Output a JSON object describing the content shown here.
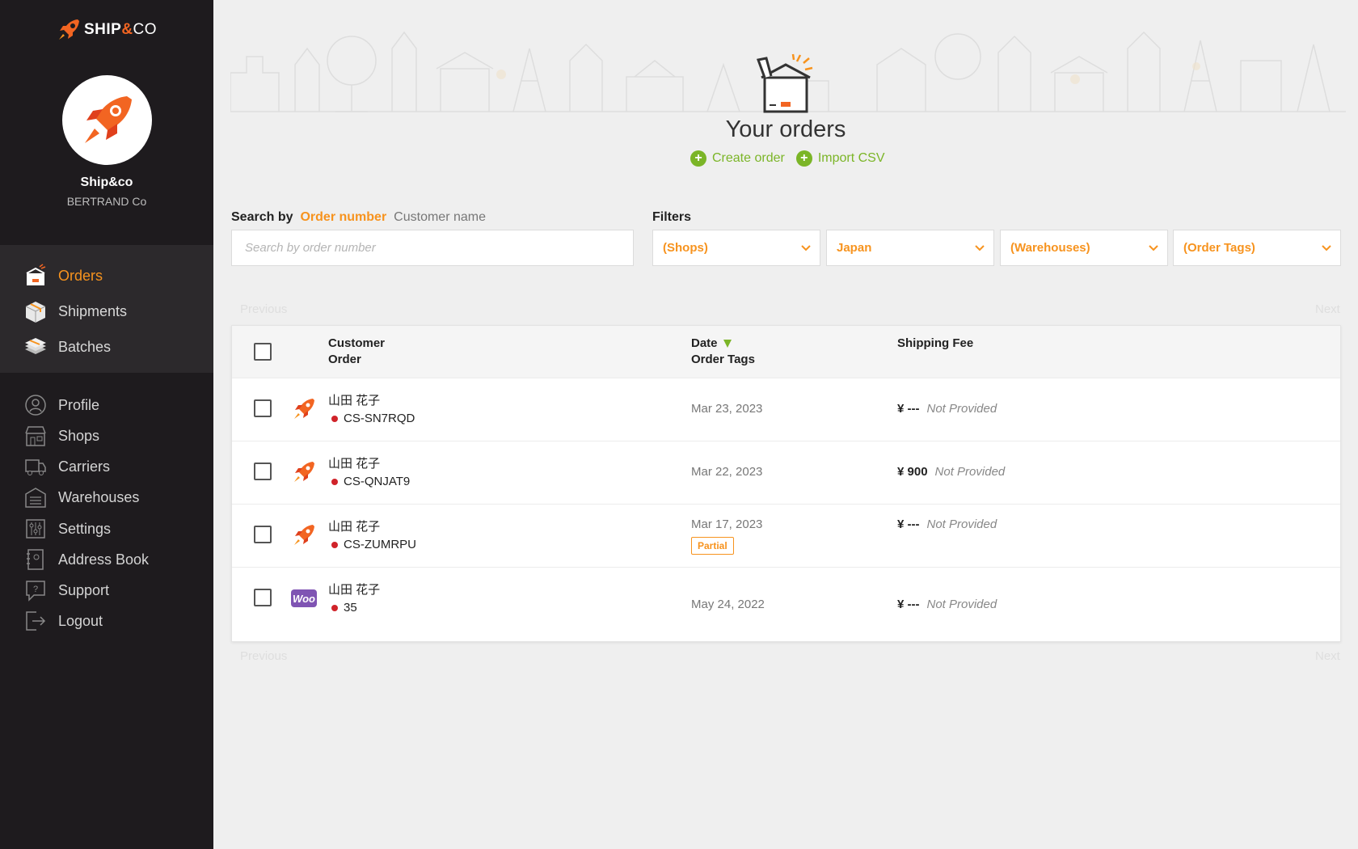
{
  "brand": {
    "name_part1": "SHIP",
    "name_amp": "&",
    "name_part2": "CO"
  },
  "account": {
    "name": "Ship&co",
    "company": "BERTRAND Co"
  },
  "nav_main": [
    {
      "label": "Orders",
      "icon": "orders-icon",
      "active": true
    },
    {
      "label": "Shipments",
      "icon": "shipments-icon"
    },
    {
      "label": "Batches",
      "icon": "batches-icon"
    }
  ],
  "nav_sub": [
    {
      "label": "Profile",
      "icon": "profile-icon"
    },
    {
      "label": "Shops",
      "icon": "shops-icon"
    },
    {
      "label": "Carriers",
      "icon": "carriers-icon"
    },
    {
      "label": "Warehouses",
      "icon": "warehouses-icon"
    },
    {
      "label": "Settings",
      "icon": "settings-icon"
    },
    {
      "label": "Address Book",
      "icon": "address-book-icon"
    },
    {
      "label": "Support",
      "icon": "support-icon"
    },
    {
      "label": "Logout",
      "icon": "logout-icon"
    }
  ],
  "hero": {
    "title": "Your orders",
    "create_order": "Create order",
    "import_csv": "Import CSV"
  },
  "search": {
    "label": "Search by",
    "option_active": "Order number",
    "option_other": "Customer name",
    "placeholder": "Search by order number"
  },
  "filters": {
    "label": "Filters",
    "shops": "(Shops)",
    "country": "Japan",
    "warehouses": "(Warehouses)",
    "order_tags": "(Order Tags)"
  },
  "pager": {
    "previous": "Previous",
    "next": "Next"
  },
  "table": {
    "headers": {
      "customer": "Customer",
      "order": "Order",
      "date": "Date",
      "order_tags": "Order Tags",
      "shipping_fee": "Shipping Fee"
    },
    "rows": [
      {
        "customer": "山田 花子",
        "order": "CS-SN7RQD",
        "date": "Mar 23, 2023",
        "fee": "¥ ---",
        "fee_status": "Not Provided",
        "shop": "shipandco",
        "tag": ""
      },
      {
        "customer": "山田 花子",
        "order": "CS-QNJAT9",
        "date": "Mar 22, 2023",
        "fee": "¥ 900",
        "fee_status": "Not Provided",
        "shop": "shipandco",
        "tag": ""
      },
      {
        "customer": "山田 花子",
        "order": "CS-ZUMRPU",
        "date": "Mar 17, 2023",
        "fee": "¥ ---",
        "fee_status": "Not Provided",
        "shop": "shipandco",
        "tag": "Partial"
      },
      {
        "customer": "山田 花子",
        "order": "35",
        "date": "May 24, 2022",
        "fee": "¥ ---",
        "fee_status": "Not Provided",
        "shop": "woocommerce",
        "tag": ""
      }
    ],
    "woo_label": "Woo"
  },
  "colors": {
    "accent": "#f7931e",
    "green": "#7bb527",
    "sidebar": "#1e1b1e"
  }
}
